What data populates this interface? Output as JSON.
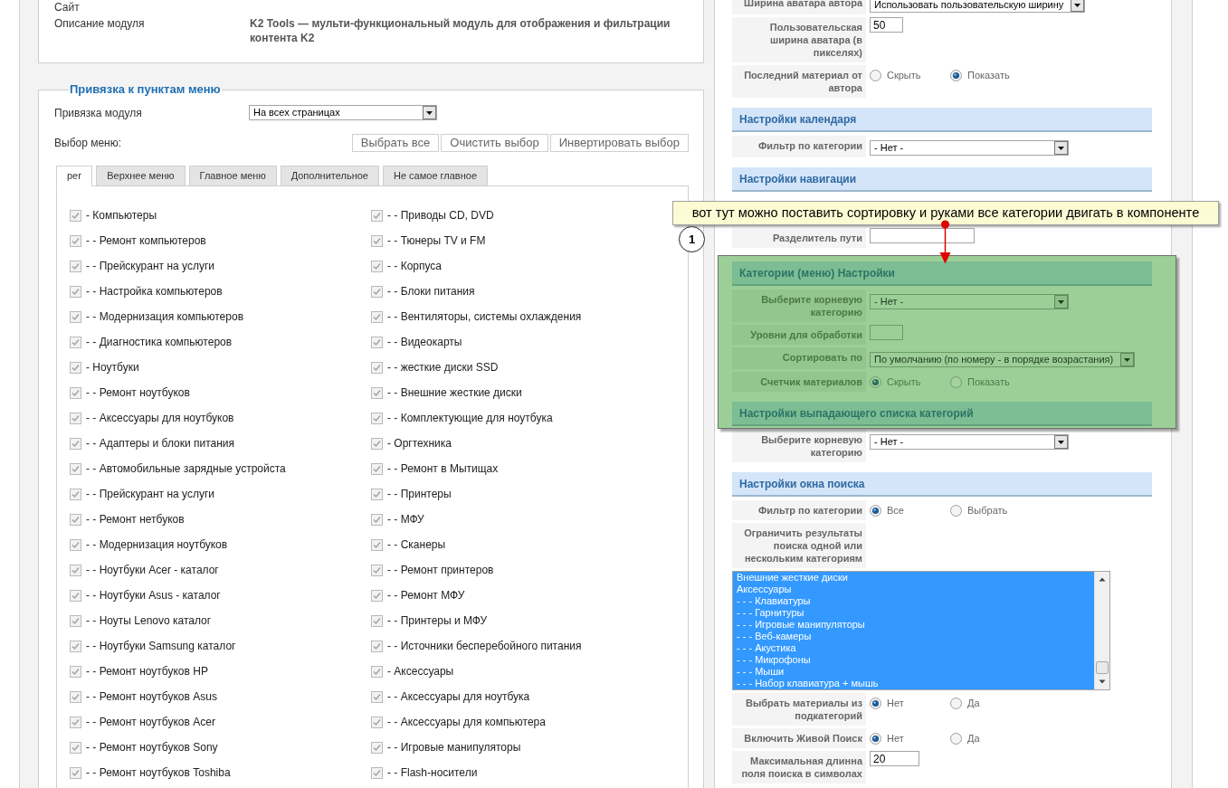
{
  "module_info": {
    "rows": [
      {
        "label": "Сайт"
      },
      {
        "label": "Описание модуля",
        "value": "K2 Tools — мульти-функциональный модуль для отображения и фильтрации контента K2"
      }
    ]
  },
  "menu_assignment": {
    "legend": "Привязка к пунктам меню",
    "assignment_label": "Привязка модуля",
    "assignment_value": "На всех страницах",
    "menu_select_label": "Выбор меню:",
    "buttons": [
      "Выбрать все",
      "Очистить выбор",
      "Инвертировать выбор"
    ],
    "tabs": [
      {
        "label": "рег",
        "selected": true
      },
      {
        "label": "Верхнее меню",
        "selected": false
      },
      {
        "label": "Главное меню",
        "selected": false
      },
      {
        "label": "Дополнительное",
        "selected": false
      },
      {
        "label": "Не самое главное",
        "selected": false
      }
    ],
    "columns": [
      {
        "items": [
          {
            "label": "- Компьютеры",
            "checked": true,
            "disabled": true
          },
          {
            "label": "- - Ремонт компьютеров",
            "checked": true,
            "disabled": true
          },
          {
            "label": "- - Прейскурант на услуги",
            "checked": true,
            "disabled": true
          },
          {
            "label": "- - Настройка компьютеров",
            "checked": true,
            "disabled": true
          },
          {
            "label": "- - Модернизация компьютеров",
            "checked": true,
            "disabled": true
          },
          {
            "label": "- - Диагностика компьютеров",
            "checked": true,
            "disabled": true
          },
          {
            "label": "- Ноутбуки",
            "checked": true,
            "disabled": true
          },
          {
            "label": "- - Ремонт ноутбуков",
            "checked": true,
            "disabled": true
          },
          {
            "label": "- - Аксессуары для ноутбуков",
            "checked": true,
            "disabled": true
          },
          {
            "label": "- - Адаптеры и блоки питания",
            "checked": true,
            "disabled": true
          },
          {
            "label": "- - Автомобильные зарядные устройста",
            "checked": true,
            "disabled": true
          },
          {
            "label": "- - Прейскурант на услуги",
            "checked": true,
            "disabled": true
          },
          {
            "label": "- - Ремонт нетбуков",
            "checked": true,
            "disabled": true
          },
          {
            "label": "- - Модернизация ноутбуков",
            "checked": true,
            "disabled": true
          },
          {
            "label": "- - Ноутбуки Acer - каталог",
            "checked": true,
            "disabled": true
          },
          {
            "label": "- - Ноутбуки Asus - каталог",
            "checked": true,
            "disabled": true
          },
          {
            "label": "- - Ноуты Lenovo каталог",
            "checked": true,
            "disabled": true
          },
          {
            "label": "- - Ноутбуки Samsung каталог",
            "checked": true,
            "disabled": true
          },
          {
            "label": "- - Ремонт ноутбуков HP",
            "checked": true,
            "disabled": true
          },
          {
            "label": "- - Ремонт ноутбуков Asus",
            "checked": true,
            "disabled": true
          },
          {
            "label": "- - Ремонт ноутбуков Acer",
            "checked": true,
            "disabled": true
          },
          {
            "label": "- - Ремонт ноутбуков Sony",
            "checked": true,
            "disabled": true
          },
          {
            "label": "- - Ремонт ноутбуков Toshiba",
            "checked": true,
            "disabled": true
          }
        ]
      },
      {
        "items": [
          {
            "label": "- - Приводы CD, DVD",
            "checked": true,
            "disabled": true
          },
          {
            "label": "- - Тюнеры TV и FM",
            "checked": true,
            "disabled": true
          },
          {
            "label": "- - Корпуса",
            "checked": true,
            "disabled": true
          },
          {
            "label": "- - Блоки питания",
            "checked": true,
            "disabled": true
          },
          {
            "label": "- - Вентиляторы, системы охлаждения",
            "checked": true,
            "disabled": true
          },
          {
            "label": "- - Видеокарты",
            "checked": true,
            "disabled": true
          },
          {
            "label": "- - жесткие диски SSD",
            "checked": true,
            "disabled": true
          },
          {
            "label": "- - Внешние жесткие диски",
            "checked": true,
            "disabled": true
          },
          {
            "label": "- - Комплектующие для ноутбука",
            "checked": true,
            "disabled": true
          },
          {
            "label": "- Оргтехника",
            "checked": true,
            "disabled": true
          },
          {
            "label": "- - Ремонт в Мытищах",
            "checked": true,
            "disabled": true
          },
          {
            "label": "- - Принтеры",
            "checked": true,
            "disabled": true
          },
          {
            "label": "- - МФУ",
            "checked": true,
            "disabled": true
          },
          {
            "label": "- - Сканеры",
            "checked": true,
            "disabled": true
          },
          {
            "label": "- - Ремонт принтеров",
            "checked": true,
            "disabled": true
          },
          {
            "label": "- - Ремонт МФУ",
            "checked": true,
            "disabled": true
          },
          {
            "label": "- - Принтеры и МФУ",
            "checked": true,
            "disabled": true
          },
          {
            "label": "- - Источники бесперебойного питания",
            "checked": true,
            "disabled": true
          },
          {
            "label": "- Аксессуары",
            "checked": true,
            "disabled": true
          },
          {
            "label": "- - Аксессуары для ноутбука",
            "checked": true,
            "disabled": true
          },
          {
            "label": "- - Аксессуары для компьютера",
            "checked": true,
            "disabled": true
          },
          {
            "label": "- - Игровые манипуляторы",
            "checked": true,
            "disabled": true
          },
          {
            "label": "- - Flash-носители",
            "checked": true,
            "disabled": true
          }
        ]
      }
    ]
  },
  "settings": [
    {
      "kind": "field",
      "label": "Ширина аватара автора",
      "control": {
        "kind": "select",
        "value": "Использовать пользовательскую ширину"
      }
    },
    {
      "kind": "field",
      "label": "Пользовательская ширина аватара (в пикселях)",
      "control": {
        "kind": "input",
        "value": "50"
      }
    },
    {
      "kind": "field",
      "label": "Последний материал от автора",
      "control": {
        "kind": "radios",
        "options": [
          {
            "label": "Скрыть",
            "selected": false
          },
          {
            "label": "Показать",
            "selected": true
          }
        ]
      }
    },
    {
      "kind": "header",
      "title": "Настройки календаря"
    },
    {
      "kind": "field",
      "label": "Фильтр по категории",
      "control": {
        "kind": "select",
        "value": "- Нет -"
      }
    },
    {
      "kind": "header",
      "title": "Настройки навигации"
    },
    {
      "kind": "covered"
    },
    {
      "kind": "field",
      "label": "Разделитель пути",
      "control": {
        "kind": "wide_input"
      }
    },
    {
      "kind": "highlight",
      "items": [
        {
          "kind": "header",
          "title": "Категории (меню) Настройки"
        },
        {
          "kind": "field",
          "label": "Выберите корневую категорию",
          "control": {
            "kind": "select",
            "value": "- Нет -"
          }
        },
        {
          "kind": "field",
          "label": "Уровни для обработки",
          "control": {
            "kind": "input"
          }
        },
        {
          "kind": "field",
          "label": "Сортировать по",
          "control": {
            "kind": "select",
            "value": "По умолчанию (по номеру - в порядке возрастания)"
          }
        },
        {
          "kind": "field",
          "label": "Счетчик материалов",
          "control": {
            "kind": "radios",
            "options": [
              {
                "label": "Скрыть",
                "selected": true
              },
              {
                "label": "Показать",
                "selected": false
              }
            ]
          }
        },
        {
          "kind": "header",
          "title": "Настройки выпадающего списка категорий"
        }
      ]
    },
    {
      "kind": "field",
      "label": "Выберите корневую категорию",
      "control": {
        "kind": "select",
        "value": "- Нет -"
      }
    },
    {
      "kind": "header",
      "title": "Настройки окна поиска"
    },
    {
      "kind": "field",
      "label": "Фильтр по категории",
      "control": {
        "kind": "radios",
        "options": [
          {
            "label": "Все",
            "selected": true
          },
          {
            "label": "Выбрать",
            "selected": false
          }
        ]
      }
    },
    {
      "kind": "field",
      "label": "Ограничить результаты поиска одной или нескольким категориям"
    },
    {
      "kind": "listbox",
      "options": [
        {
          "label": "Внешние жесткие диски",
          "selected": true
        },
        {
          "label": "Аксессуары",
          "selected": true
        },
        {
          "label": "- - - Клавиатуры",
          "selected": true
        },
        {
          "label": "- - - Гарнитуры",
          "selected": true
        },
        {
          "label": "- - - Игровые манипуляторы",
          "selected": true
        },
        {
          "label": "- - - Веб-камеры",
          "selected": true
        },
        {
          "label": "- - - Акустика",
          "selected": true
        },
        {
          "label": "- - - Микрофоны",
          "selected": true
        },
        {
          "label": "- - - Мыши",
          "selected": true
        },
        {
          "label": "- - - Набор клавиатура + мышь",
          "selected": true
        }
      ]
    },
    {
      "kind": "field",
      "label": "Выбрать материалы из подкатегорий",
      "control": {
        "kind": "radios",
        "options": [
          {
            "label": "Нет",
            "selected": true
          },
          {
            "label": "Да",
            "selected": false
          }
        ]
      }
    },
    {
      "kind": "field",
      "label": "Включить Живой Поиск",
      "control": {
        "kind": "radios",
        "options": [
          {
            "label": "Нет",
            "selected": true
          },
          {
            "label": "Да",
            "selected": false
          }
        ]
      }
    },
    {
      "kind": "field",
      "label": "Максимальная длинна поля поиска в символах",
      "control": {
        "kind": "medium_input",
        "value": "20"
      }
    }
  ],
  "annotation": {
    "callout": "вот тут можно поставить сортировку и руками все категории двигать в компоненте",
    "marker": "1"
  }
}
